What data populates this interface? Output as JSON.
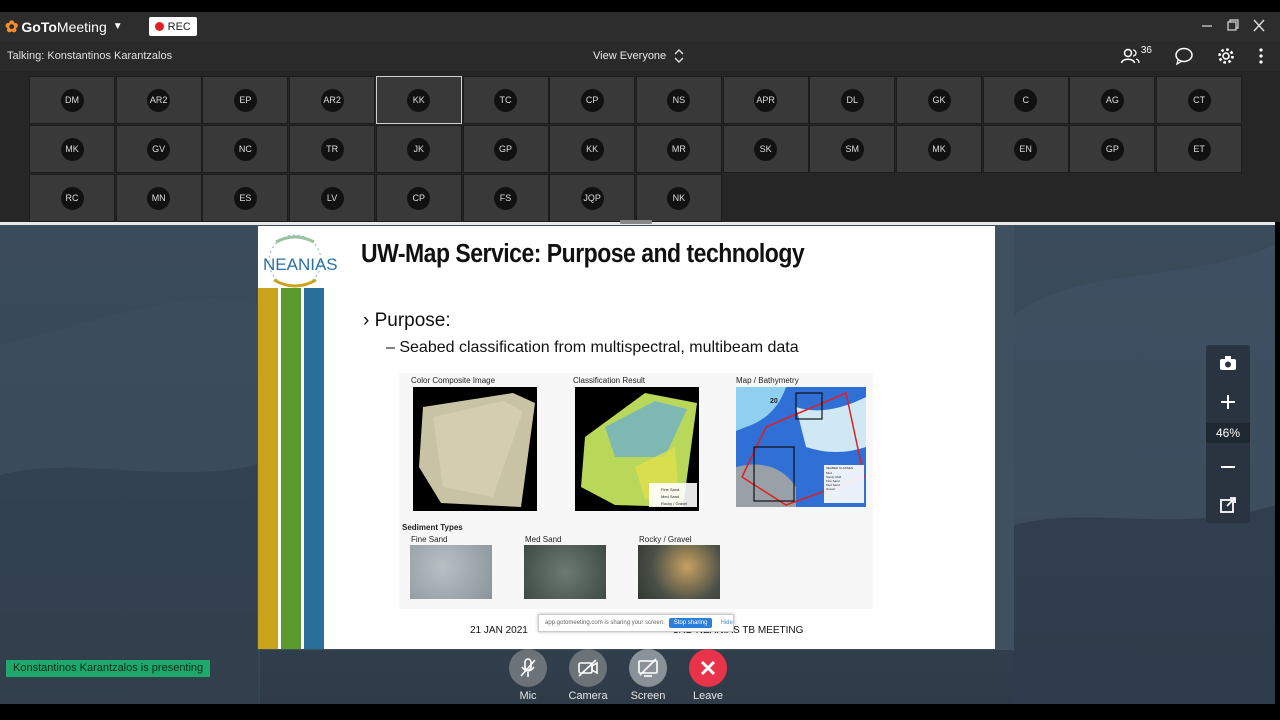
{
  "app": {
    "logo_brand": "GoTo",
    "logo_product": "Meeting",
    "rec_label": "REC"
  },
  "talkbar": {
    "talking": "Talking: Konstantinos Karantzalos",
    "view_label": "View Everyone",
    "participant_count": "36"
  },
  "participants": [
    "DM",
    "AR2",
    "EP",
    "AR2",
    "KK",
    "TC",
    "CP",
    "NS",
    "APR",
    "DL",
    "GK",
    "C",
    "AG",
    "CT",
    "MK",
    "GV",
    "NC",
    "TR",
    "JK",
    "GP",
    "KK",
    "MR",
    "SK",
    "SM",
    "MK",
    "EN",
    "GP",
    "ET",
    "RC",
    "MN",
    "ES",
    "LV",
    "CP",
    "FS",
    "JQP",
    "NK"
  ],
  "active_participant_index": 4,
  "slide": {
    "logo_text": "NEANIAS",
    "title": "UW-Map Service: Purpose and technology",
    "bullet": "Purpose:",
    "sub_bullet": "Seabed classification from multispectral, multibeam data",
    "fig_labels": {
      "color_composite": "Color Composite Image",
      "classification": "Classification Result",
      "map": "Map / Bathymetry",
      "sediment": "Sediment Types",
      "fine_sand": "Fine Sand",
      "med_sand": "Med Sand",
      "rocky": "Rocky / Gravel",
      "legend_fine": "Fine Sand",
      "legend_med": "Med Sand",
      "legend_rocky": "Rocky / Gravel",
      "map_depth": "20",
      "map_legend_title": "SEABED CLASSES",
      "map_legend_items": [
        "Mud",
        "Sandy Mud",
        "Fine Sand",
        "Med Sand",
        "Gravel"
      ]
    },
    "footer_date": "21 JAN 2021",
    "footer_meeting": "3RD NEANIAS TB MEETING",
    "share_text": "app.gotomeeting.com is sharing your screen.",
    "stop_sharing": "Stop sharing",
    "hide": "Hide"
  },
  "zoom": {
    "value": "46%"
  },
  "presenting_banner": "Konstantinos Karantzalos is presenting",
  "controls": {
    "mic": "Mic",
    "camera": "Camera",
    "screen": "Screen",
    "leave": "Leave"
  },
  "colors": {
    "leave": "#e8334a",
    "control_gray": "#6b7278",
    "presenting": "#1fa86b",
    "stripe_gold": "#c9a31a",
    "stripe_green": "#5a9a2a",
    "stripe_blue": "#2a6f9a"
  }
}
